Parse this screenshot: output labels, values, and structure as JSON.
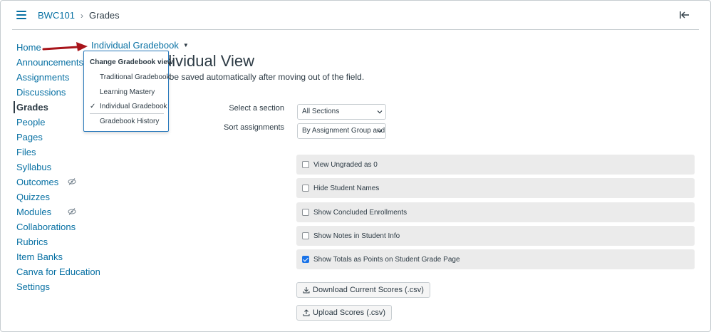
{
  "header": {
    "course": "BWC101",
    "separator": "›",
    "current": "Grades"
  },
  "sidebar": {
    "items": [
      {
        "label": "Home"
      },
      {
        "label": "Announcements"
      },
      {
        "label": "Assignments"
      },
      {
        "label": "Discussions"
      },
      {
        "label": "Grades",
        "active": true
      },
      {
        "label": "People"
      },
      {
        "label": "Pages"
      },
      {
        "label": "Files"
      },
      {
        "label": "Syllabus"
      },
      {
        "label": "Outcomes",
        "hidden_icon": "eye-slash-icon"
      },
      {
        "label": "Quizzes"
      },
      {
        "label": "Modules",
        "hidden_icon": "eye-slash-icon"
      },
      {
        "label": "Collaborations"
      },
      {
        "label": "Rubrics"
      },
      {
        "label": "Item Banks"
      },
      {
        "label": "Canva for Education"
      },
      {
        "label": "Settings"
      }
    ]
  },
  "main": {
    "gradebook_menu_label": "Individual Gradebook",
    "title_visible": "dividual View",
    "description_visible": "ll be saved automatically after moving out of the field.",
    "section_label": "Select a section",
    "section_value": "All Sections",
    "sort_label": "Sort assignments",
    "sort_value": "By Assignment Group and Po",
    "options": [
      {
        "label": "View Ungraded as 0",
        "checked": false
      },
      {
        "label": "Hide Student Names",
        "checked": false
      },
      {
        "label": "Show Concluded Enrollments",
        "checked": false
      },
      {
        "label": "Show Notes in Student Info",
        "checked": false
      },
      {
        "label": "Show Totals as Points on Student Grade Page",
        "checked": true
      }
    ],
    "download_button": "Download Current Scores (.csv)",
    "upload_button": "Upload Scores (.csv)"
  },
  "dropdown": {
    "heading": "Change Gradebook view",
    "items": [
      {
        "label": "Traditional Gradebook",
        "selected": false
      },
      {
        "label": "Learning Mastery",
        "selected": false
      },
      {
        "label": "Individual Gradebook",
        "selected": true
      },
      {
        "label": "Gradebook History",
        "selected": false
      }
    ],
    "check_glyph": "✓"
  },
  "colors": {
    "link": "#0770a3",
    "text": "#2d3b45",
    "arrow": "#a8141a",
    "option_bg": "#ebebeb",
    "dropdown_border": "#2b7abc"
  }
}
